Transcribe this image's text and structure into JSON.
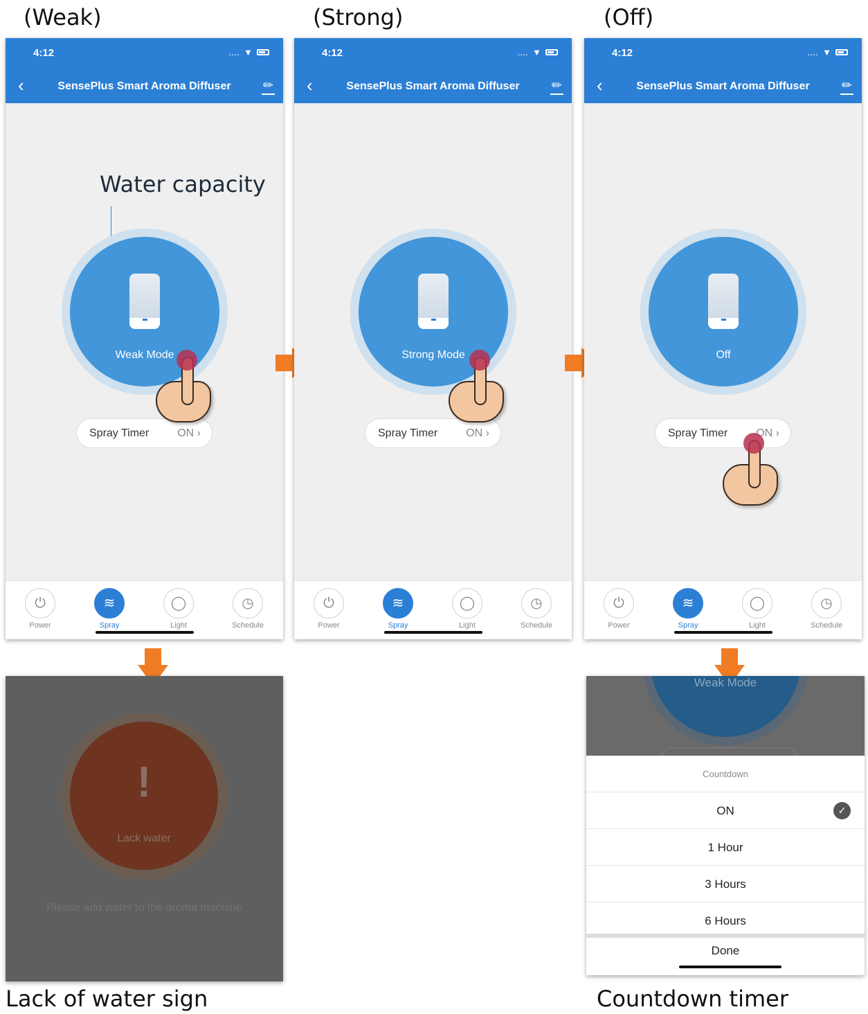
{
  "captions": {
    "weak": "(Weak)",
    "strong": "(Strong)",
    "off": "(Off)",
    "lack_water_sign": "Lack of water sign",
    "countdown_timer": "Countdown timer"
  },
  "annotation": {
    "water_capacity": "Water capacity"
  },
  "app": {
    "status_time": "4:12",
    "status_signal": "....",
    "title": "SensePlus Smart Aroma Diffuser",
    "back_icon": "chevron-left-icon",
    "edit_icon": "pencil-icon",
    "accent_color": "#2b7fd5"
  },
  "screens": [
    {
      "mode_label": "Weak Mode",
      "spray_timer_label": "Spray Timer",
      "spray_timer_value": "ON ›"
    },
    {
      "mode_label": "Strong Mode",
      "spray_timer_label": "Spray Timer",
      "spray_timer_value": "ON ›"
    },
    {
      "mode_label": "Off",
      "spray_timer_label": "Spray Timer",
      "spray_timer_value": "ON ›"
    }
  ],
  "tabbar": [
    {
      "label": "Power",
      "icon": "power-icon",
      "active": false
    },
    {
      "label": "Spray",
      "icon": "spray-icon",
      "active": true
    },
    {
      "label": "Light",
      "icon": "bulb-icon",
      "active": false
    },
    {
      "label": "Schedule",
      "icon": "clock-icon",
      "active": false
    }
  ],
  "lack_water": {
    "symbol": "!",
    "label": "Lack water",
    "message": "Please add water to the aroma machine",
    "color": "#6e341f"
  },
  "countdown": {
    "background_mode": "Weak Mode",
    "title": "Countdown",
    "options": [
      "ON",
      "1 Hour",
      "3 Hours",
      "6 Hours"
    ],
    "selected": "ON",
    "done_label": "Done"
  }
}
